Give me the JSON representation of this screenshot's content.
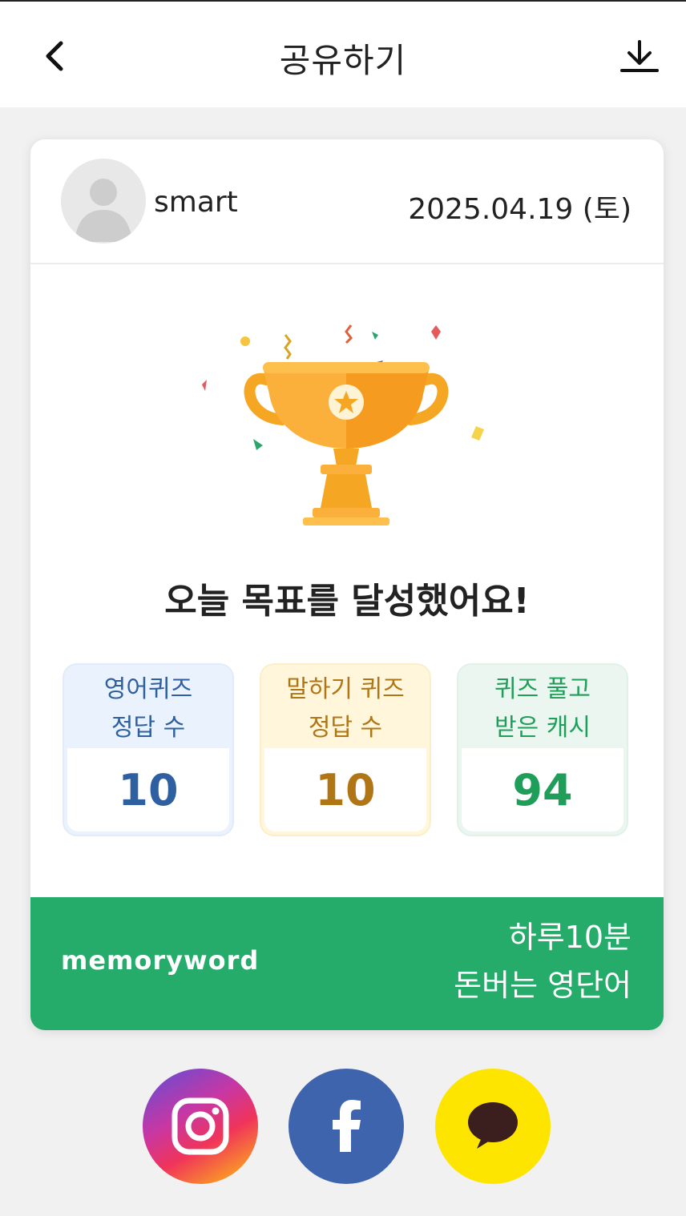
{
  "header": {
    "title": "공유하기",
    "back_icon": "chevron-left-icon",
    "download_icon": "download-icon"
  },
  "profile": {
    "username": "smart",
    "date": "2025.04.19 (토)",
    "avatar_icon": "user-avatar-icon"
  },
  "achievement": {
    "headline": "오늘 목표를 달성했어요!",
    "illustration_icon": "trophy-icon"
  },
  "stats": [
    {
      "label": "영어퀴즈\n정답 수",
      "value": "10",
      "color": "#2e5fa1"
    },
    {
      "label": "말하기 퀴즈\n정답 수",
      "value": "10",
      "color": "#b07615"
    },
    {
      "label": "퀴즈 풀고\n받은 캐시",
      "value": "94",
      "color": "#1f9e5a"
    }
  ],
  "banner": {
    "brand": "memoryword",
    "slogan_line1": "하루10분",
    "slogan_line2": "돈버는 영단어",
    "background": "#25ac6a"
  },
  "share_buttons": [
    {
      "name": "instagram",
      "icon": "instagram-icon"
    },
    {
      "name": "facebook",
      "icon": "facebook-icon"
    },
    {
      "name": "kakaotalk",
      "icon": "kakaotalk-icon"
    }
  ]
}
